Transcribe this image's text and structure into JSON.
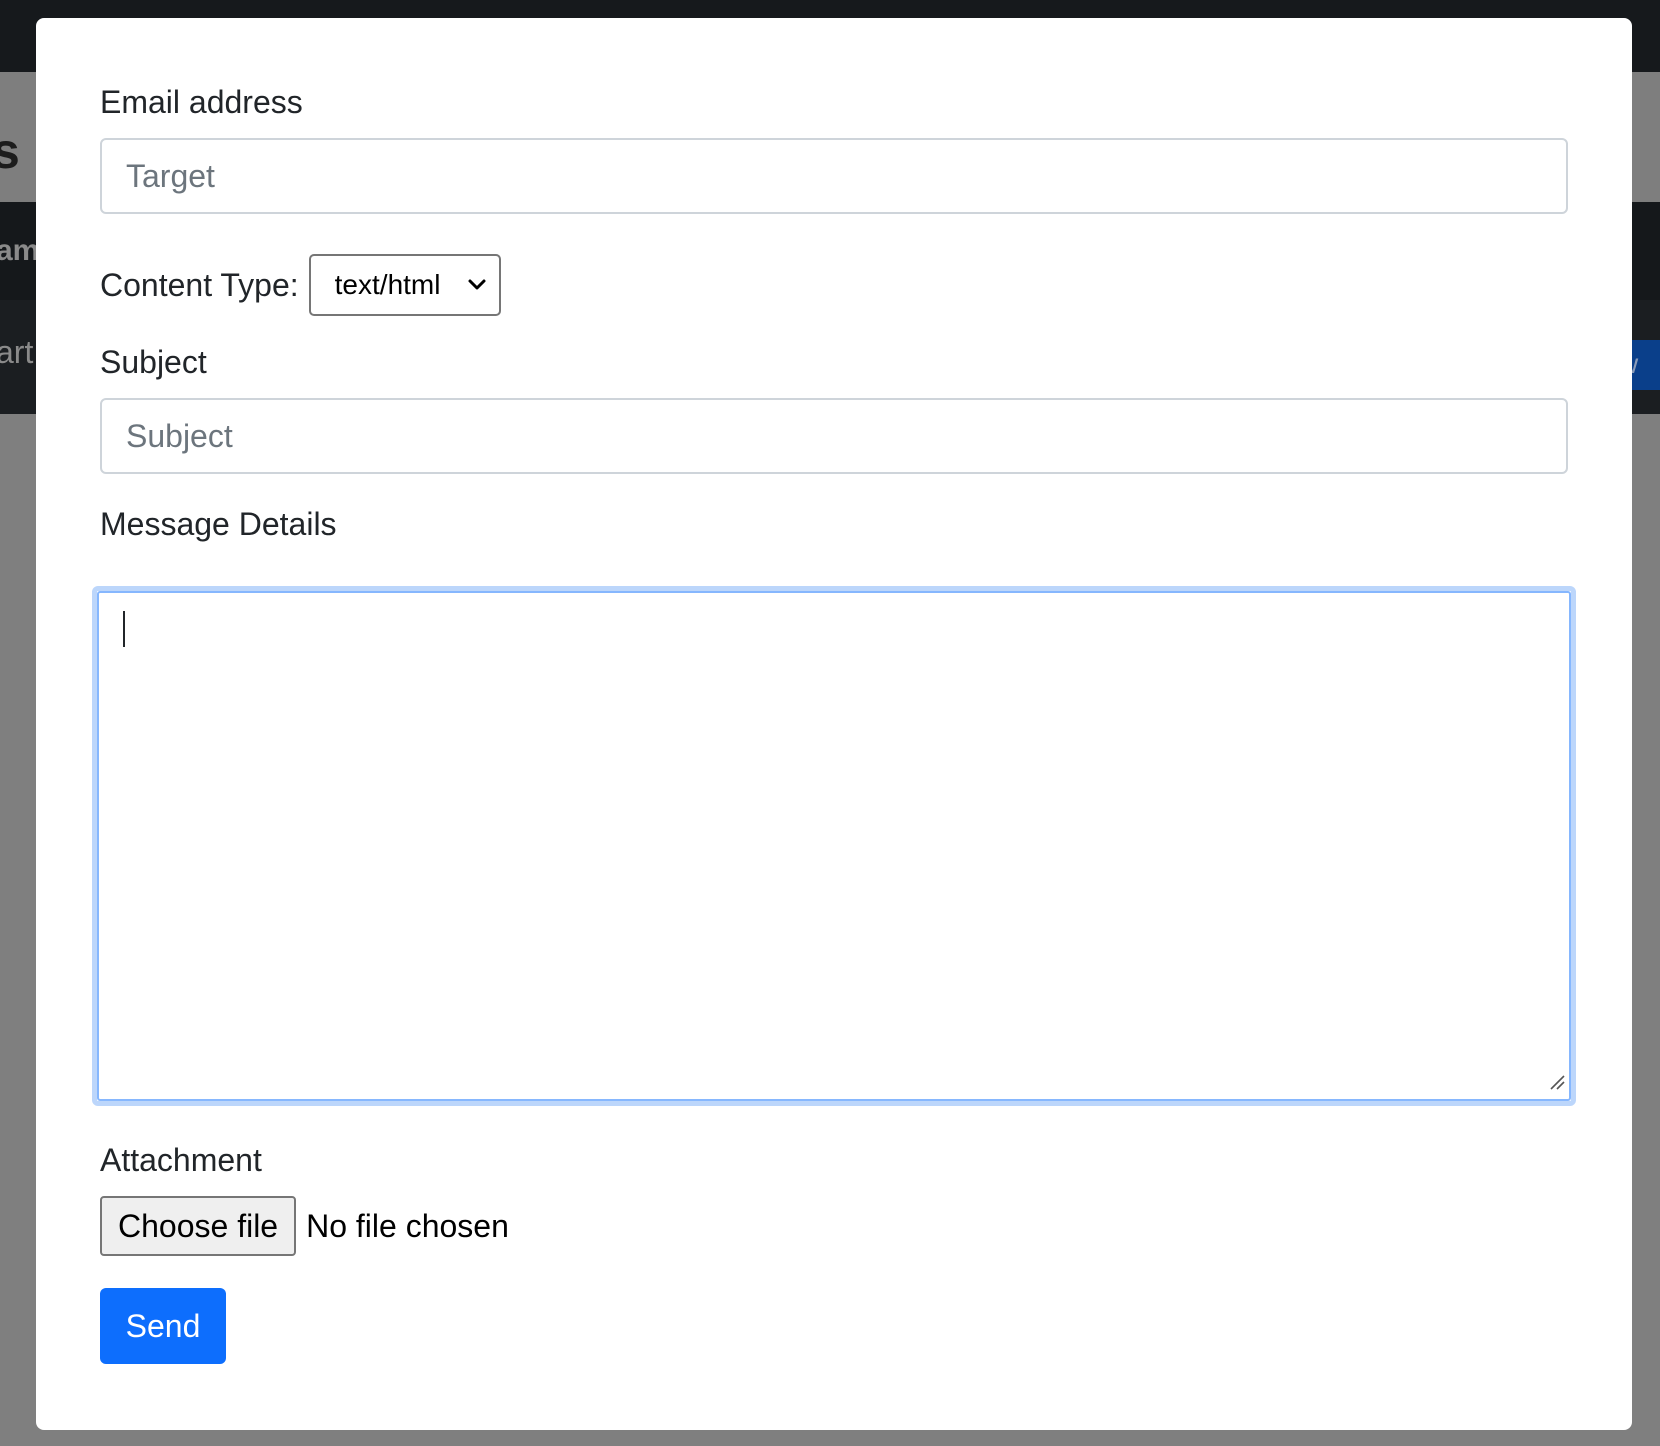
{
  "background_page": {
    "title_fragment": "s",
    "nav_fragment": "am",
    "sub_fragment": "art",
    "button_fragment": "w"
  },
  "form": {
    "email": {
      "label": "Email address",
      "placeholder": "Target",
      "value": ""
    },
    "content_type": {
      "label": "Content Type:",
      "selected": "text/html",
      "icon": "chevron-down-icon"
    },
    "subject": {
      "label": "Subject",
      "placeholder": "Subject",
      "value": ""
    },
    "message": {
      "label": "Message Details",
      "value": ""
    },
    "attachment": {
      "label": "Attachment",
      "button_label": "Choose file",
      "status": "No file chosen"
    },
    "send_label": "Send"
  },
  "colors": {
    "primary": "#0d6efd",
    "focus_ring": "#bcd6fb",
    "focus_border": "#86b7fe",
    "input_border": "#ced4da",
    "overlay": "#7f7f7f"
  }
}
